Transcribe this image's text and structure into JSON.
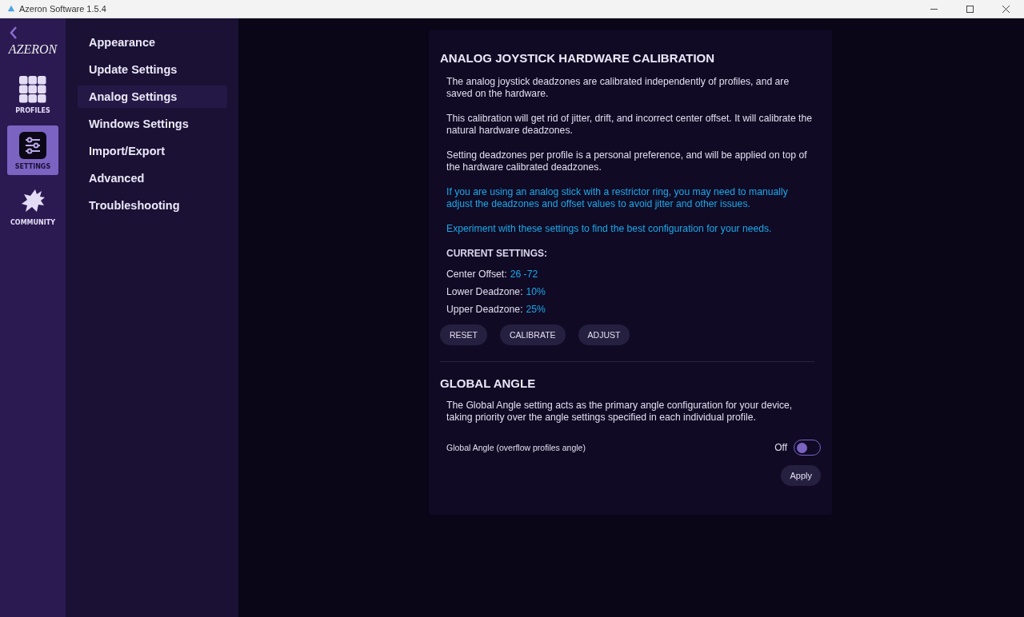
{
  "window": {
    "title": "Azeron Software 1.5.4"
  },
  "rail": {
    "logo": "AZERON",
    "items": [
      {
        "label": "PROFILES",
        "kind": "grid",
        "selected": false
      },
      {
        "label": "SETTINGS",
        "kind": "sliders",
        "selected": true
      },
      {
        "label": "COMMUNITY",
        "kind": "dragon",
        "selected": false
      }
    ]
  },
  "nav": [
    {
      "label": "Appearance",
      "selected": false
    },
    {
      "label": "Update Settings",
      "selected": false
    },
    {
      "label": "Analog Settings",
      "selected": true
    },
    {
      "label": "Windows Settings",
      "selected": false
    },
    {
      "label": "Import/Export",
      "selected": false
    },
    {
      "label": "Advanced",
      "selected": false
    },
    {
      "label": "Troubleshooting",
      "selected": false
    }
  ],
  "calibration": {
    "title": "ANALOG JOYSTICK HARDWARE CALIBRATION",
    "paragraphs": [
      {
        "kind": "normal",
        "text": "The analog joystick deadzones are calibrated independently of profiles, and are saved on the hardware."
      },
      {
        "kind": "normal",
        "text": "This calibration will get rid of jitter, drift, and incorrect center offset. It will calibrate the natural hardware deadzones."
      },
      {
        "kind": "normal",
        "text": "Setting deadzones per profile is a personal preference, and will be applied on top of the hardware calibrated deadzones."
      },
      {
        "kind": "highlight",
        "text": "If you are using an analog stick with a restrictor ring, you may need to manually adjust the deadzones and offset values to avoid jitter and other issues."
      },
      {
        "kind": "highlight",
        "text": "Experiment with these settings to find the best configuration for your needs."
      }
    ],
    "current_settings": {
      "heading": "CURRENT SETTINGS:",
      "rows": [
        {
          "label": "Center Offset:",
          "value": "26 -72"
        },
        {
          "label": "Lower Deadzone:",
          "value": "10%"
        },
        {
          "label": "Upper Deadzone:",
          "value": "25%"
        }
      ]
    },
    "buttons": [
      "RESET",
      "CALIBRATE",
      "ADJUST"
    ]
  },
  "global_angle": {
    "title": "GLOBAL ANGLE",
    "description": "The Global Angle setting acts as the primary angle configuration for your device, taking priority over the angle settings specified in each individual profile.",
    "toggle": {
      "label": "Global Angle (overflow profiles angle)",
      "state_text": "Off",
      "on": false
    },
    "apply_button": "Apply"
  }
}
